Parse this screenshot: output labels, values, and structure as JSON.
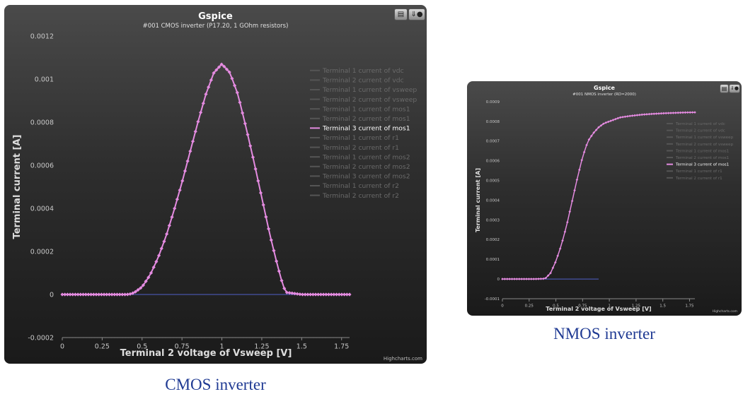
{
  "colors": {
    "series_pink": "#e48be0",
    "zero_line": "#5060c8",
    "axis_text": "#c8c8c8",
    "legend_dim": "#6a6a6a",
    "legend_active": "#ffffff",
    "caption": "#1f3a93"
  },
  "icons": [
    "print-icon",
    "export-icon"
  ],
  "captions": {
    "cmos": "CMOS inverter",
    "nmos": "NMOS inverter"
  },
  "chart_data": [
    {
      "type": "line",
      "title": "Gspice",
      "subtitle": "#001 CMOS inverter (P17.20, 1 GOhm resistors)",
      "xlabel": "Terminal 2 voltage of Vsweep [V]",
      "ylabel": "Terminal current [A]",
      "credits": "Highcharts.com",
      "xlim": [
        0,
        1.8
      ],
      "ylim": [
        -0.0002,
        0.0012
      ],
      "xticks": [
        0,
        0.25,
        0.5,
        0.75,
        1,
        1.25,
        1.5,
        1.75
      ],
      "xtick_labels": [
        "0",
        "0.25",
        "0.5",
        "0.75",
        "1",
        "1.25",
        "1.5",
        "1.75"
      ],
      "yticks": [
        -0.0002,
        0,
        0.0002,
        0.0004,
        0.0006,
        0.0008,
        0.001,
        0.0012
      ],
      "ytick_labels": [
        "-0.0002",
        "0",
        "0.0002",
        "0.0004",
        "0.0006",
        "0.0008",
        "0.001",
        "0.0012"
      ],
      "grid": false,
      "legend_position": "right",
      "legend": [
        {
          "label": "Terminal 1 current of vdc",
          "active": false
        },
        {
          "label": "Terminal 2 current of vdc",
          "active": false
        },
        {
          "label": "Terminal 1 current of vsweep",
          "active": false
        },
        {
          "label": "Terminal 2 current of vsweep",
          "active": false
        },
        {
          "label": "Terminal 1 current of mos1",
          "active": false
        },
        {
          "label": "Terminal 2 current of mos1",
          "active": false
        },
        {
          "label": "Terminal 3 current of mos1",
          "active": true
        },
        {
          "label": "Terminal 1 current of r1",
          "active": false
        },
        {
          "label": "Terminal 2 current of r1",
          "active": false
        },
        {
          "label": "Terminal 1 current of mos2",
          "active": false
        },
        {
          "label": "Terminal 2 current of mos2",
          "active": false
        },
        {
          "label": "Terminal 3 current of mos2",
          "active": false
        },
        {
          "label": "Terminal 1 current of r2",
          "active": false
        },
        {
          "label": "Terminal 2 current of r2",
          "active": false
        }
      ],
      "series": [
        {
          "name": "Terminal 3 current of mos1",
          "x": [
            0,
            0.1,
            0.2,
            0.3,
            0.4,
            0.42,
            0.45,
            0.5,
            0.55,
            0.6,
            0.65,
            0.7,
            0.75,
            0.8,
            0.85,
            0.9,
            0.95,
            1.0,
            1.05,
            1.1,
            1.15,
            1.2,
            1.25,
            1.3,
            1.35,
            1.38,
            1.4,
            1.5,
            1.6,
            1.7,
            1.8
          ],
          "y": [
            0,
            0,
            0,
            0,
            0,
            1e-06,
            8e-06,
            3.5e-05,
            9e-05,
            0.00017,
            0.00027,
            0.00039,
            0.00052,
            0.00066,
            0.0008,
            0.00093,
            0.00103,
            0.00107,
            0.00103,
            0.00093,
            0.00078,
            0.00062,
            0.00045,
            0.00028,
            0.00013,
            5e-05,
            1e-05,
            0,
            0,
            0,
            0
          ]
        },
        {
          "name": "",
          "x": [
            0,
            1.8
          ],
          "y": [
            0,
            0
          ]
        }
      ]
    },
    {
      "type": "line",
      "title": "Gspice",
      "subtitle": "#001 NMOS inverter (RD=2000)",
      "xlabel": "Terminal 2 voltage of Vsweep [V]",
      "ylabel": "Terminal current [A]",
      "credits": "Highcharts.com",
      "xlim": [
        0,
        1.8
      ],
      "ylim": [
        -0.0001,
        0.0009
      ],
      "xticks": [
        0,
        0.25,
        0.5,
        0.75,
        1,
        1.25,
        1.5,
        1.75
      ],
      "xtick_labels": [
        "0",
        "0.25",
        "0.5",
        "0.75",
        "1",
        "1.25",
        "1.5",
        "1.75"
      ],
      "yticks": [
        -0.0001,
        0,
        0.0001,
        0.0002,
        0.0003,
        0.0004,
        0.0005,
        0.0006,
        0.0007,
        0.0008,
        0.0009
      ],
      "ytick_labels": [
        "-0.0001",
        "0",
        "0.0001",
        "0.0002",
        "0.0003",
        "0.0004",
        "0.0005",
        "0.0006",
        "0.0007",
        "0.0008",
        "0.0009"
      ],
      "grid": false,
      "legend_position": "right",
      "legend": [
        {
          "label": "Terminal 1 current of vdc",
          "active": false
        },
        {
          "label": "Terminal 2 current of vdc",
          "active": false
        },
        {
          "label": "Terminal 1 current of vsweep",
          "active": false
        },
        {
          "label": "Terminal 2 current of vsweep",
          "active": false
        },
        {
          "label": "Terminal 1 current of mos1",
          "active": false
        },
        {
          "label": "Terminal 2 current of mos1",
          "active": false
        },
        {
          "label": "Terminal 3 current of mos1",
          "active": true
        },
        {
          "label": "Terminal 1 current of r1",
          "active": false
        },
        {
          "label": "Terminal 2 current of r1",
          "active": false
        }
      ],
      "series": [
        {
          "name": "Terminal 3 current of mos1",
          "x": [
            0,
            0.1,
            0.2,
            0.3,
            0.4,
            0.45,
            0.5,
            0.55,
            0.6,
            0.65,
            0.7,
            0.75,
            0.8,
            0.85,
            0.9,
            0.95,
            1.0,
            1.1,
            1.2,
            1.3,
            1.4,
            1.5,
            1.6,
            1.7,
            1.8
          ],
          "y": [
            0,
            0,
            0,
            0,
            2e-06,
            3e-05,
            9e-05,
            0.00017,
            0.00027,
            0.00039,
            0.00051,
            0.00062,
            0.0007,
            0.00074,
            0.00077,
            0.00079,
            0.0008,
            0.00082,
            0.000828,
            0.000834,
            0.000838,
            0.000841,
            0.000843,
            0.000845,
            0.000846
          ]
        },
        {
          "name": "",
          "x": [
            0,
            0.9
          ],
          "y": [
            0,
            0
          ]
        }
      ]
    }
  ]
}
